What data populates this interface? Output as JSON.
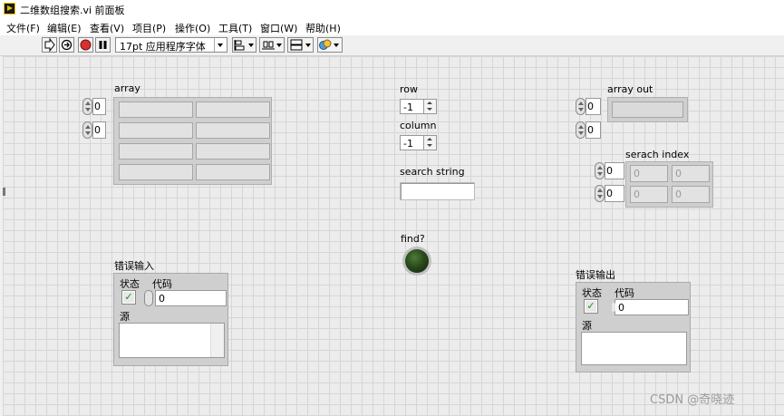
{
  "window": {
    "title": "二维数组搜索.vi 前面板"
  },
  "menu": [
    "文件(F)",
    "编辑(E)",
    "查看(V)",
    "项目(P)",
    "操作(O)",
    "工具(T)",
    "窗口(W)",
    "帮助(H)"
  ],
  "toolbar": {
    "font": "17pt 应用程序字体",
    "buttons": [
      "run-arrow-icon",
      "run-continuously-icon",
      "abort-icon",
      "pause-icon",
      "align-objects-icon",
      "distribute-objects-icon",
      "resize-objects-icon",
      "reorder-icon"
    ]
  },
  "panel": {
    "array": {
      "label": "array",
      "index0": "0",
      "index1": "0"
    },
    "row": {
      "label": "row",
      "value": "-1"
    },
    "column": {
      "label": "column",
      "value": "-1"
    },
    "search_string": {
      "label": "search string",
      "value": ""
    },
    "find": {
      "label": "find?",
      "state": "off"
    },
    "array_out": {
      "label": "array out",
      "index0": "0",
      "index1": "0"
    },
    "search_index": {
      "label": "serach index",
      "index0": "0",
      "index1": "0",
      "cells": [
        "0",
        "0",
        "0",
        "0"
      ]
    },
    "error_in": {
      "label": "错误输入",
      "status_label": "状态",
      "code_label": "代码",
      "code": "0",
      "source_label": "源",
      "source": ""
    },
    "error_out": {
      "label": "错误输出",
      "status_label": "状态",
      "code_label": "代码",
      "code": "0",
      "source_label": "源",
      "source": ""
    }
  },
  "watermark": "CSDN @奇晓迹",
  "colors": {
    "led_off": "#2a4a1c",
    "status_check": "#1a8a1a"
  }
}
